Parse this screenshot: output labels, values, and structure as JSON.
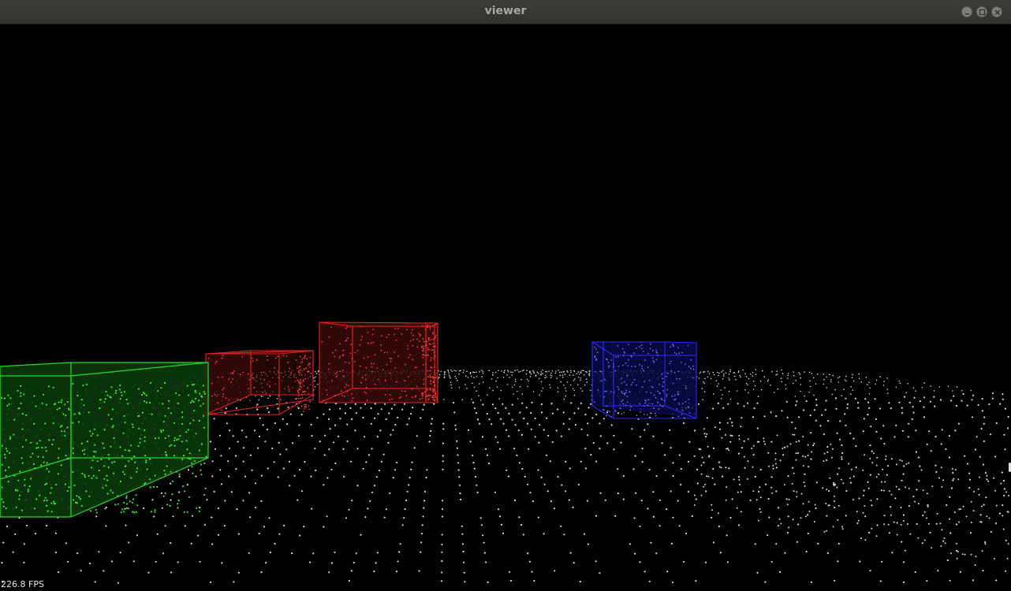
{
  "window": {
    "title": "viewer",
    "controls": {
      "minimize": "minimize-icon",
      "maximize": "maximize-icon",
      "close": "close-icon"
    }
  },
  "viewport": {
    "fps_label": "226.8 FPS",
    "background": "#000000",
    "ground_points_color": "#d8d8d8",
    "boxes": [
      {
        "name": "green-bounding-box",
        "color": "#22dd22",
        "fill": "#0d4a0d"
      },
      {
        "name": "red-bounding-box-left",
        "color": "#dd2222",
        "fill": "#4a0d0d"
      },
      {
        "name": "red-bounding-box-center",
        "color": "#ee2222",
        "fill": "#4a0d0d"
      },
      {
        "name": "blue-bounding-box",
        "color": "#2a2aff",
        "fill": "#0d0d55"
      }
    ]
  }
}
